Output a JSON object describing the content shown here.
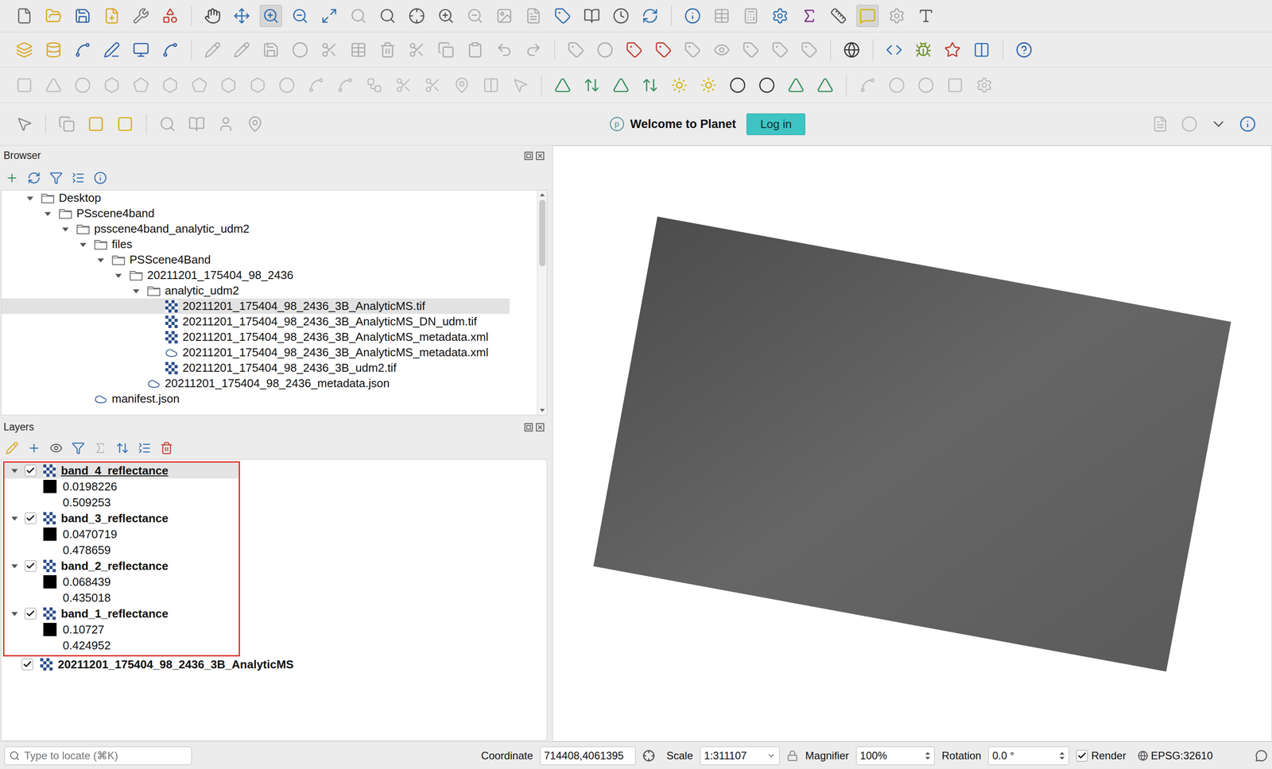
{
  "toolbar": {
    "planet": {
      "logo": "p",
      "message": "Welcome to Planet",
      "button": "Log in"
    }
  },
  "browser": {
    "title": "Browser",
    "items": [
      {
        "label": "Desktop",
        "depth": 0,
        "kind": "folder",
        "expanded": true,
        "selected": false
      },
      {
        "label": "PSscene4band",
        "depth": 1,
        "kind": "folder",
        "expanded": true,
        "selected": false
      },
      {
        "label": "psscene4band_analytic_udm2",
        "depth": 2,
        "kind": "folder",
        "expanded": true,
        "selected": false
      },
      {
        "label": "files",
        "depth": 3,
        "kind": "folder",
        "expanded": true,
        "selected": false
      },
      {
        "label": "PSScene4Band",
        "depth": 4,
        "kind": "folder",
        "expanded": true,
        "selected": false
      },
      {
        "label": "20211201_175404_98_2436",
        "depth": 5,
        "kind": "folder",
        "expanded": true,
        "selected": false
      },
      {
        "label": "analytic_udm2",
        "depth": 6,
        "kind": "folder",
        "expanded": true,
        "selected": false
      },
      {
        "label": "20211201_175404_98_2436_3B_AnalyticMS.tif",
        "depth": 7,
        "kind": "raster",
        "expanded": false,
        "selected": true
      },
      {
        "label": "20211201_175404_98_2436_3B_AnalyticMS_DN_udm.tif",
        "depth": 7,
        "kind": "raster",
        "expanded": false,
        "selected": false
      },
      {
        "label": "20211201_175404_98_2436_3B_AnalyticMS_metadata.xml",
        "depth": 7,
        "kind": "raster",
        "expanded": false,
        "selected": false
      },
      {
        "label": "20211201_175404_98_2436_3B_AnalyticMS_metadata.xml",
        "depth": 7,
        "kind": "vector",
        "expanded": false,
        "selected": false
      },
      {
        "label": "20211201_175404_98_2436_3B_udm2.tif",
        "depth": 7,
        "kind": "raster",
        "expanded": false,
        "selected": false
      },
      {
        "label": "20211201_175404_98_2436_metadata.json",
        "depth": 6,
        "kind": "vector",
        "expanded": false,
        "selected": false
      },
      {
        "label": "manifest.json",
        "depth": 3,
        "kind": "vector",
        "expanded": false,
        "selected": false
      }
    ]
  },
  "layers": {
    "title": "Layers",
    "items": [
      {
        "name": "band_4_reflectance",
        "checked": true,
        "expanded": true,
        "selected": true,
        "annotated": true,
        "legend": {
          "min": "0.0198226",
          "max": "0.509253"
        }
      },
      {
        "name": "band_3_reflectance",
        "checked": true,
        "expanded": true,
        "selected": false,
        "annotated": true,
        "legend": {
          "min": "0.0470719",
          "max": "0.478659"
        }
      },
      {
        "name": "band_2_reflectance",
        "checked": true,
        "expanded": true,
        "selected": false,
        "annotated": true,
        "legend": {
          "min": "0.068439",
          "max": "0.435018"
        }
      },
      {
        "name": "band_1_reflectance",
        "checked": true,
        "expanded": true,
        "selected": false,
        "annotated": true,
        "legend": {
          "min": "0.10727",
          "max": "0.424952"
        }
      },
      {
        "name": "20211201_175404_98_2436_3B_AnalyticMS",
        "checked": true,
        "expanded": false,
        "selected": false,
        "annotated": false,
        "legend": null
      }
    ]
  },
  "map": {
    "raster": {
      "color": "#666666"
    }
  },
  "status_bar": {
    "locator_placeholder": "Type to locate (⌘K)",
    "coordinate_label": "Coordinate",
    "coordinate": "714408,4061395",
    "scale_label": "Scale",
    "scale": "1:311107",
    "magnifier_label": "Magnifier",
    "magnifier": "100%",
    "rotation_label": "Rotation",
    "rotation": "0.0 °",
    "render_label": "Render",
    "render": true,
    "crs": "EPSG:32610"
  }
}
